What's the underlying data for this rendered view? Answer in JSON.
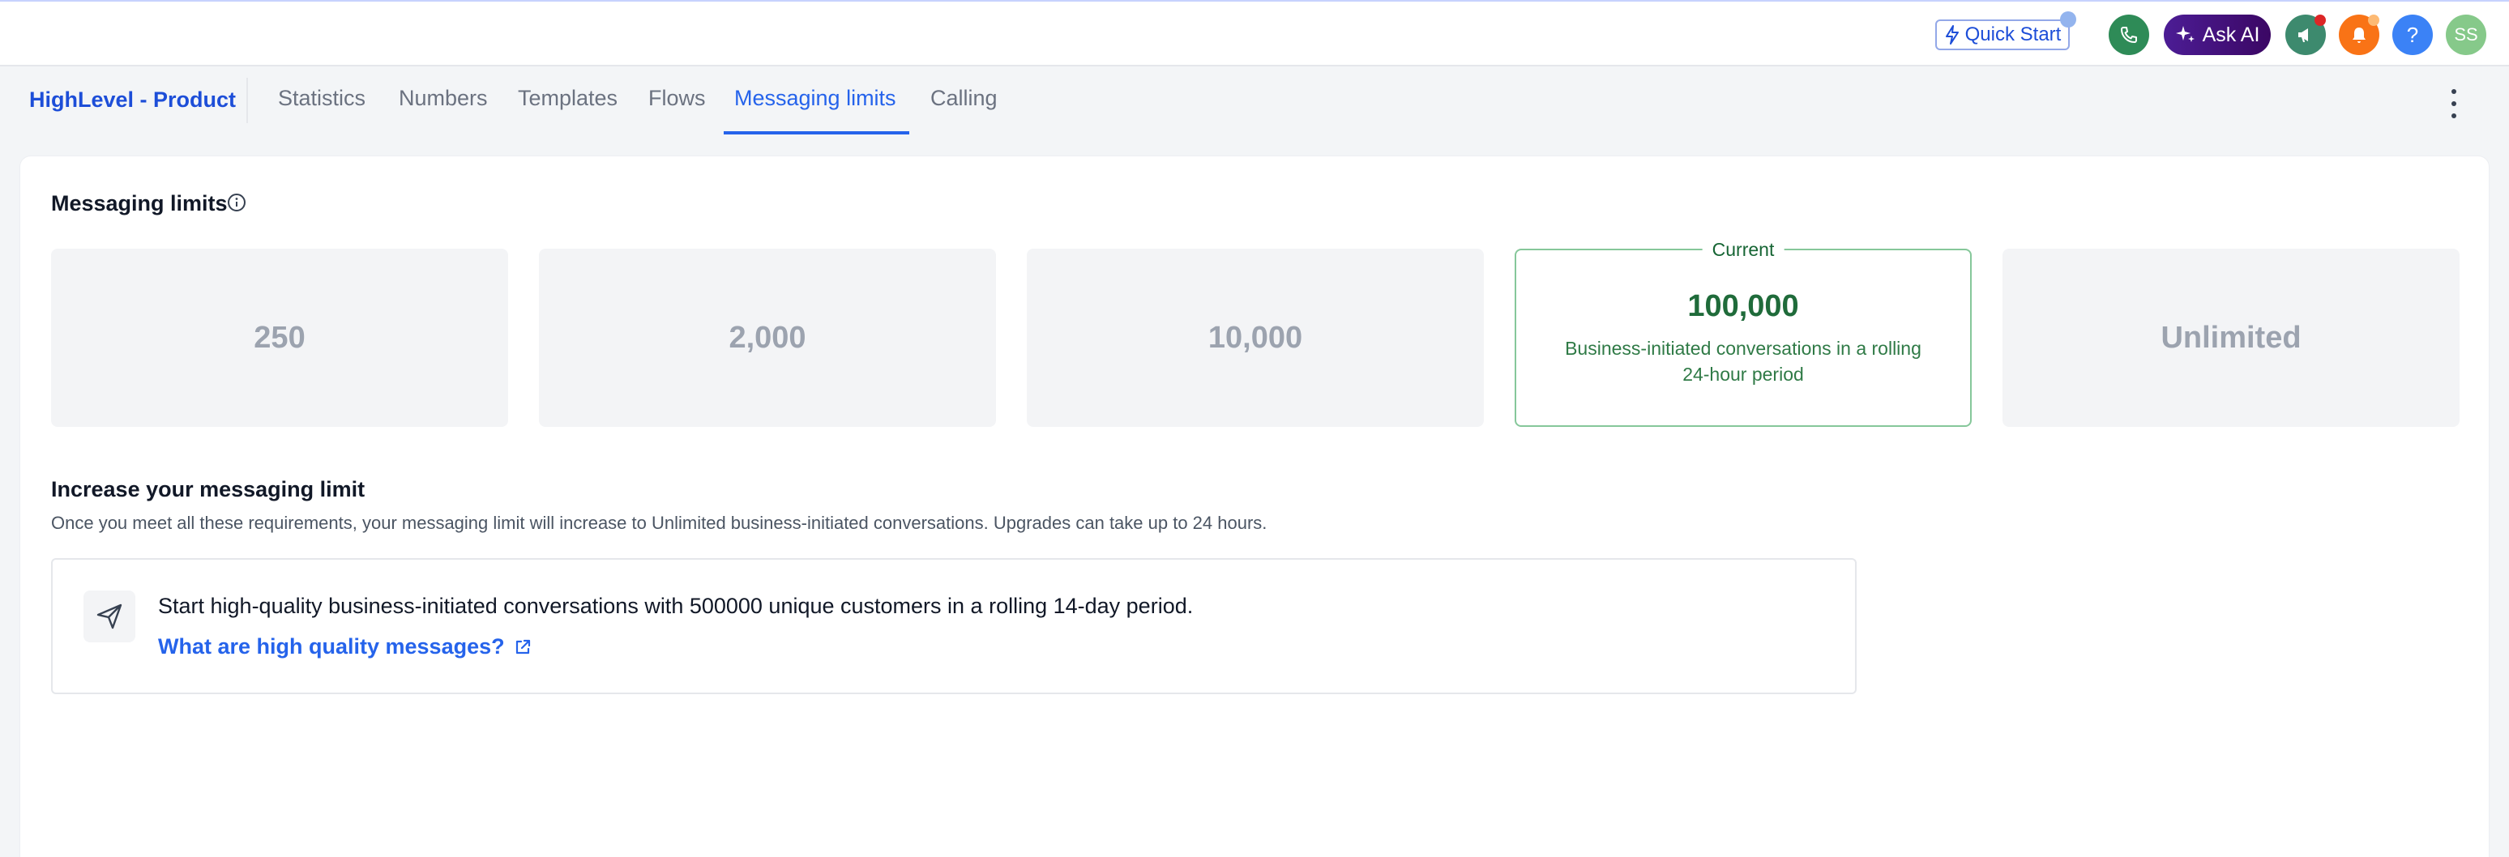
{
  "topbar": {
    "quick_start_label": "Quick Start",
    "ask_ai_label": "Ask AI",
    "help_label": "?",
    "avatar_initials": "SS",
    "colors": {
      "phone": "#2e8b57",
      "announce": "#3d8a6e",
      "notif": "#f97316",
      "help": "#3b82f6",
      "avatar": "#86c98a"
    }
  },
  "nav": {
    "brand": "HighLevel - Product",
    "tabs": [
      {
        "label": "Statistics"
      },
      {
        "label": "Numbers"
      },
      {
        "label": "Templates"
      },
      {
        "label": "Flows"
      },
      {
        "label": "Messaging limits",
        "active": true
      },
      {
        "label": "Calling"
      }
    ]
  },
  "main": {
    "title": "Messaging limits",
    "limits": [
      {
        "value": "250"
      },
      {
        "value": "2,000"
      },
      {
        "value": "10,000"
      },
      {
        "value": "100,000",
        "tag": "Current",
        "description": "Business-initiated conversations in a rolling 24-hour period"
      },
      {
        "value": "Unlimited"
      }
    ],
    "increase": {
      "title": "Increase your messaging limit",
      "description": "Once you meet all these requirements, your messaging limit will increase to Unlimited business-initiated conversations. Upgrades can take up to 24 hours.",
      "requirement_text": "Start high-quality business-initiated conversations with 500000 unique customers in a rolling 14-day period.",
      "requirement_link": "What are high quality messages?"
    }
  }
}
